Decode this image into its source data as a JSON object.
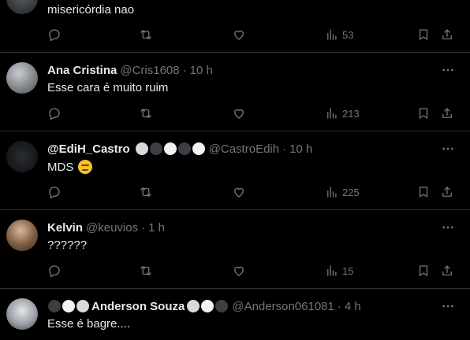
{
  "colors": {
    "background": "#000000",
    "divider": "#2f3336",
    "text_primary": "#e7e9ea",
    "text_secondary": "#71767b"
  },
  "icons": {
    "reply": "reply-icon",
    "retweet": "retweet-icon",
    "like": "heart-icon",
    "views": "views-icon",
    "bookmark": "bookmark-icon",
    "share": "share-icon",
    "more": "more-icon"
  },
  "tweets": [
    {
      "name": "",
      "handle": "",
      "time": "",
      "text": "misericórdia nao",
      "views": "53"
    },
    {
      "name": "Ana Cristina",
      "handle": "@Cris1608",
      "time": "10 h",
      "text": "Esse cara é muito ruim",
      "views": "213"
    },
    {
      "name": "@EdiH_Castro",
      "handle": "@CastroEdih",
      "time": "10 h",
      "text": "MDS",
      "views": "225"
    },
    {
      "name": "Kelvin",
      "handle": "@keuvios",
      "time": "1 h",
      "text": "??????",
      "views": "15"
    },
    {
      "name": "Anderson Souza",
      "handle": "@Anderson061081",
      "time": "4 h",
      "text": "Esse é bagre....",
      "views": ""
    }
  ]
}
